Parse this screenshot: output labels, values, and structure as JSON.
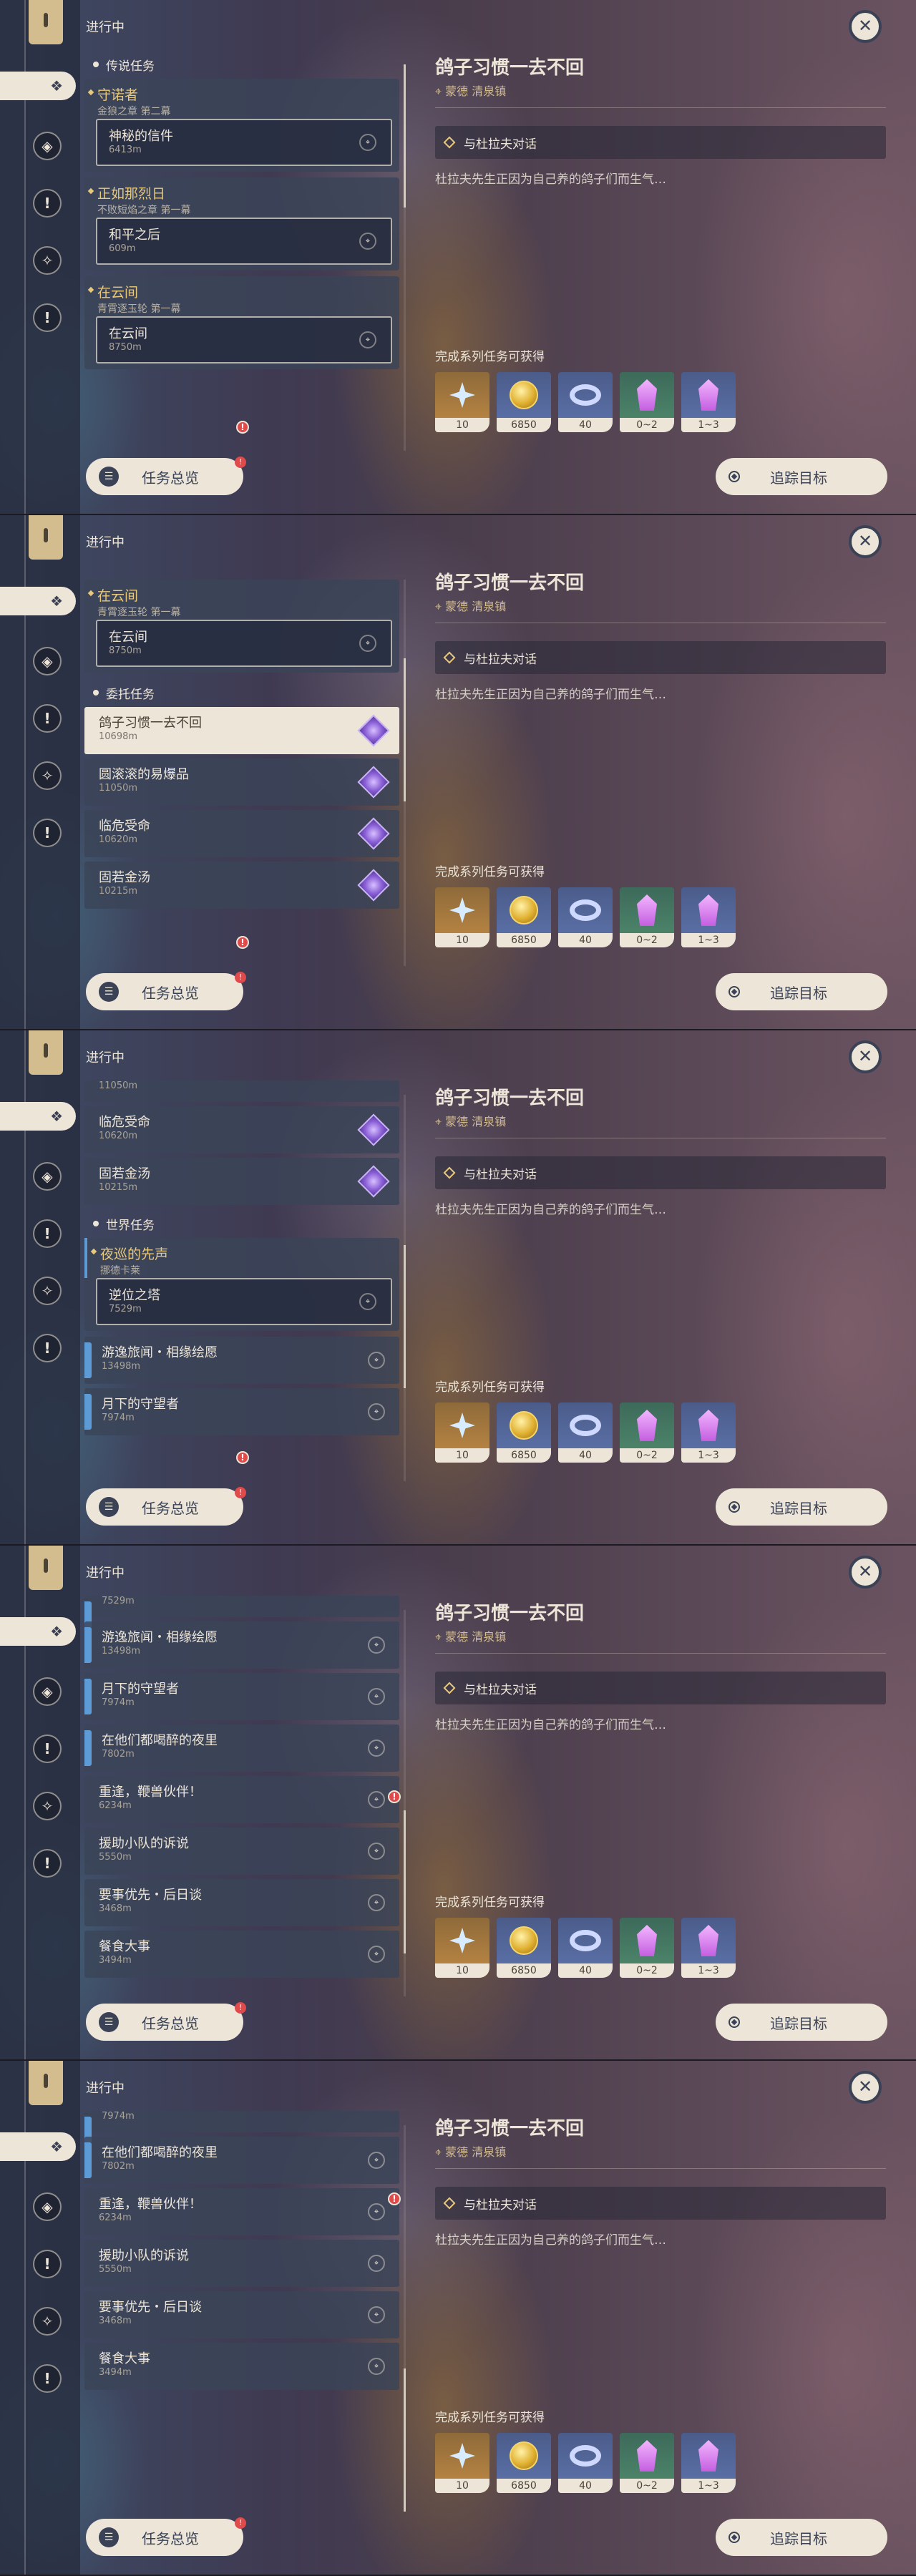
{
  "header": {
    "title": "进行中"
  },
  "sections": {
    "legend": "传说任务",
    "commission": "委托任务",
    "world": "世界任务"
  },
  "legend_groups": [
    {
      "title": "守诺者",
      "subtitle": "金狼之章 第二幕",
      "sub": {
        "title": "神秘的信件",
        "dist": "6413m"
      }
    },
    {
      "title": "正如那烈日",
      "subtitle": "不败短焰之章 第一幕",
      "sub": {
        "title": "和平之后",
        "dist": "609m"
      }
    },
    {
      "title": "在云间",
      "subtitle": "青霄逐玉轮 第一幕",
      "sub": {
        "title": "在云间",
        "dist": "8750m"
      }
    }
  ],
  "commissions": [
    {
      "title": "鸽子习惯一去不回",
      "dist": "10698m"
    },
    {
      "title": "圆滚滚的易爆品",
      "dist": "11050m"
    },
    {
      "title": "临危受命",
      "dist": "10620m"
    },
    {
      "title": "固若金汤",
      "dist": "10215m"
    }
  ],
  "world_group": {
    "title": "夜巡的先声",
    "subtitle": "挪德卡莱",
    "sub": {
      "title": "逆位之塔",
      "dist": "7529m"
    }
  },
  "world_items": [
    {
      "title": "游逸旅闻・相缘绘愿",
      "dist": "13498m"
    },
    {
      "title": "月下的守望者",
      "dist": "7974m"
    },
    {
      "title": "在他们都喝醉的夜里",
      "dist": "7802m"
    },
    {
      "title": "重逢，鞭兽伙伴！",
      "dist": "6234m"
    },
    {
      "title": "援助小队的诉说",
      "dist": "5550m"
    },
    {
      "title": "要事优先・后日谈",
      "dist": "3468m"
    },
    {
      "title": "餐食大事",
      "dist": "3494m"
    }
  ],
  "footer": {
    "overview_label": "任务总览",
    "track_label": "追踪目标"
  },
  "detail": {
    "title": "鸽子习惯一去不回",
    "location": "蒙德 清泉镇",
    "objective": "与杜拉夫对话",
    "description": "杜拉夫先生正因为自己养的鸽子们而生气…",
    "reward_title": "完成系列任务可获得",
    "rewards": [
      {
        "icon": "intertwined-fate-star-icon",
        "count": "10",
        "color": "#c08a44"
      },
      {
        "icon": "mora-coin-icon",
        "count": "6850",
        "color": "#5e74ad"
      },
      {
        "icon": "adventure-exp-ring-icon",
        "count": "40",
        "color": "#5e74ad"
      },
      {
        "icon": "crystal-chunk-icon",
        "count": "0~2",
        "color": "#4f8b6d"
      },
      {
        "icon": "crystal-cluster-icon",
        "count": "1~3",
        "color": "#5e74ad"
      }
    ]
  },
  "colors": {
    "gold": "#e8c87a",
    "cream": "#ece5d8",
    "world_blue": "#5d9bd6",
    "alert_red": "#e04a4a"
  }
}
